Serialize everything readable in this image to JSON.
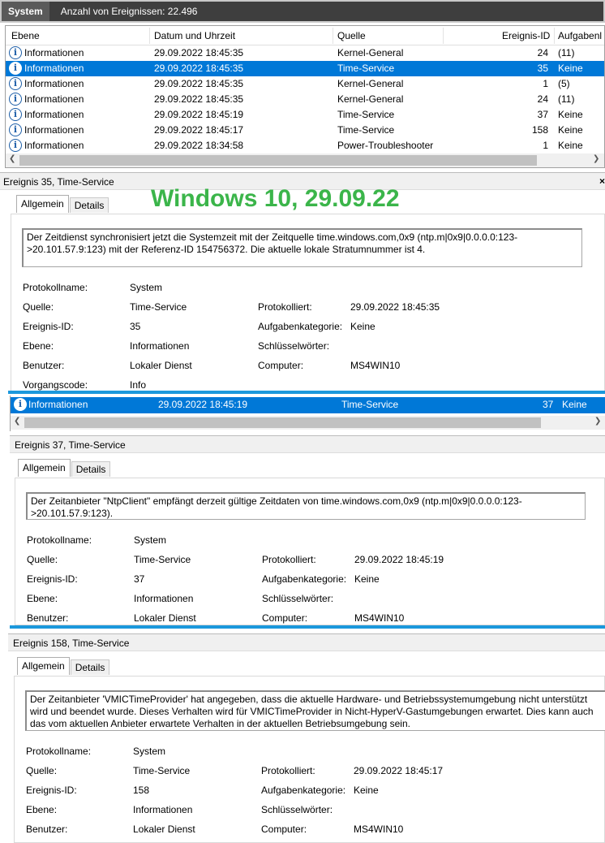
{
  "titlebar": {
    "log_name": "System",
    "count_text": "Anzahl von Ereignissen: 22.496"
  },
  "columns": {
    "ebene": "Ebene",
    "datum": "Datum und Uhrzeit",
    "quelle": "Quelle",
    "id": "Ereignis-ID",
    "aufgabe": "Aufgabenl"
  },
  "events": [
    {
      "level": "Informationen",
      "date": "29.09.2022 18:45:35",
      "source": "Kernel-General",
      "id": "24",
      "task": "(11)",
      "selected": false
    },
    {
      "level": "Informationen",
      "date": "29.09.2022 18:45:35",
      "source": "Time-Service",
      "id": "35",
      "task": "Keine",
      "selected": true
    },
    {
      "level": "Informationen",
      "date": "29.09.2022 18:45:35",
      "source": "Kernel-General",
      "id": "1",
      "task": "(5)",
      "selected": false
    },
    {
      "level": "Informationen",
      "date": "29.09.2022 18:45:35",
      "source": "Kernel-General",
      "id": "24",
      "task": "(11)",
      "selected": false
    },
    {
      "level": "Informationen",
      "date": "29.09.2022 18:45:19",
      "source": "Time-Service",
      "id": "37",
      "task": "Keine",
      "selected": false
    },
    {
      "level": "Informationen",
      "date": "29.09.2022 18:45:17",
      "source": "Time-Service",
      "id": "158",
      "task": "Keine",
      "selected": false
    },
    {
      "level": "Informationen",
      "date": "29.09.2022 18:34:58",
      "source": "Power-Troubleshooter",
      "id": "1",
      "task": "Keine",
      "selected": false
    }
  ],
  "watermark": "Windows 10, 29.09.22",
  "labels": {
    "allgemein": "Allgemein",
    "details": "Details",
    "protokollname": "Protokollname:",
    "quelle": "Quelle:",
    "ereignis_id": "Ereignis-ID:",
    "ebene": "Ebene:",
    "benutzer": "Benutzer:",
    "vorgangscode": "Vorgangscode:",
    "protokolliert": "Protokolliert:",
    "aufgabenkategorie": "Aufgabenkategorie:",
    "schluesselwoerter": "Schlüsselwörter:",
    "computer": "Computer:"
  },
  "panel1": {
    "title": "Ereignis 35, Time-Service",
    "message": "Der Zeitdienst synchronisiert jetzt die Systemzeit mit der Zeitquelle time.windows.com,0x9 (ntp.m|0x9|0.0.0.0:123->20.101.57.9:123) mit der Referenz-ID 154756372. Die aktuelle lokale Stratumnummer ist 4.",
    "protokollname": "System",
    "quelle": "Time-Service",
    "ereignis_id": "35",
    "ebene": "Informationen",
    "benutzer": "Lokaler Dienst",
    "vorgangscode": "Info",
    "protokolliert": "29.09.2022 18:45:35",
    "aufgabenkategorie": "Keine",
    "computer": "MS4WIN10"
  },
  "mini_row": {
    "level": "Informationen",
    "date": "29.09.2022 18:45:19",
    "source": "Time-Service",
    "id": "37",
    "task": "Keine"
  },
  "panel2": {
    "title": "Ereignis 37, Time-Service",
    "message": "Der Zeitanbieter \"NtpClient\" empfängt derzeit gültige Zeitdaten von time.windows.com,0x9 (ntp.m|0x9|0.0.0.0:123->20.101.57.9:123).",
    "protokollname": "System",
    "quelle": "Time-Service",
    "ereignis_id": "37",
    "ebene": "Informationen",
    "benutzer": "Lokaler Dienst",
    "protokolliert": "29.09.2022 18:45:19",
    "aufgabenkategorie": "Keine",
    "computer": "MS4WIN10"
  },
  "panel3": {
    "title": "Ereignis 158, Time-Service",
    "message": "Der Zeitanbieter 'VMICTimeProvider' hat angegeben, dass die aktuelle Hardware- und Betriebssystemumgebung nicht unterstützt wird und beendet wurde. Dieses Verhalten wird für VMICTimeProvider in Nicht-HyperV-Gastumgebungen erwartet. Dies kann auch das vom aktuellen Anbieter erwartete Verhalten in der aktuellen Betriebsumgebung sein.",
    "protokollname": "System",
    "quelle": "Time-Service",
    "ereignis_id": "158",
    "ebene": "Informationen",
    "benutzer": "Lokaler Dienst",
    "protokolliert": "29.09.2022 18:45:17",
    "aufgabenkategorie": "Keine",
    "computer": "MS4WIN10"
  }
}
